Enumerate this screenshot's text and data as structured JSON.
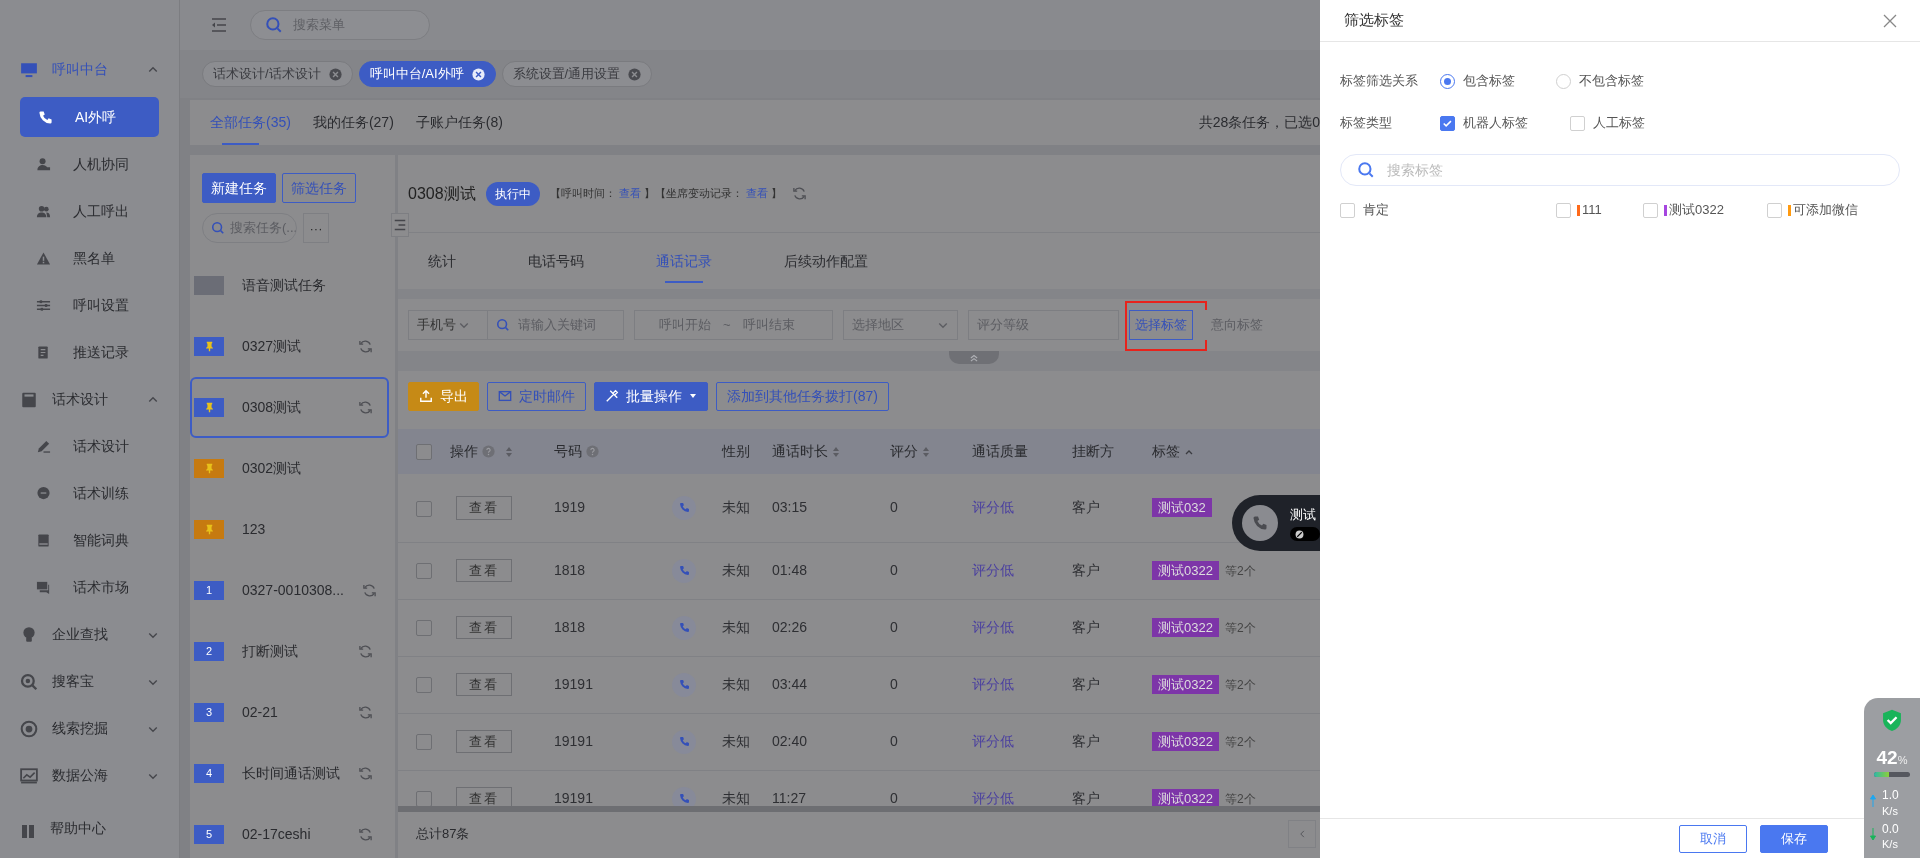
{
  "top_bar": {
    "search": {
      "placeholder": "搜索菜单"
    }
  },
  "page_tabs": [
    {
      "label": "话术设计/话术设计",
      "selected": false
    },
    {
      "label": "呼叫中台/AI外呼",
      "selected": true
    },
    {
      "label": "系统设置/通用设置",
      "selected": false
    }
  ],
  "sidebar": {
    "groups": [
      {
        "label": "呼叫中台",
        "expanded": true,
        "children": [
          {
            "label": "AI外呼",
            "selected": true
          },
          {
            "label": "人机协同",
            "selected": false
          },
          {
            "label": "人工呼出",
            "selected": false
          },
          {
            "label": "黑名单",
            "selected": false
          },
          {
            "label": "呼叫设置",
            "selected": false
          },
          {
            "label": "推送记录",
            "selected": false
          }
        ]
      },
      {
        "label": "话术设计",
        "expanded": true,
        "children": [
          {
            "label": "话术设计",
            "selected": false
          },
          {
            "label": "话术训练",
            "selected": false
          },
          {
            "label": "智能词典",
            "selected": false
          },
          {
            "label": "话术市场",
            "selected": false
          }
        ]
      },
      {
        "label": "企业查找",
        "expanded": false
      },
      {
        "label": "搜客宝",
        "expanded": false
      },
      {
        "label": "线索挖掘",
        "expanded": false
      },
      {
        "label": "数据公海",
        "expanded": false
      }
    ],
    "footer": "帮助中心"
  },
  "task_tabs": [
    {
      "label": "全部任务(35)",
      "selected": true
    },
    {
      "label": "我的任务(27)",
      "selected": false
    },
    {
      "label": "子账户任务(8)",
      "selected": false
    }
  ],
  "task_summary": "共28条任务，已选0",
  "task_panel": {
    "buttons": [
      {
        "label": "新建任务",
        "kind": "primary"
      },
      {
        "label": "筛选任务",
        "kind": "outline"
      }
    ],
    "search": {
      "placeholder": "搜索任务(..."
    },
    "more_button": "···"
  },
  "tasks": [
    {
      "name": "语音测试任务",
      "kind": "blank",
      "color": "#6b6d76",
      "refresh": false,
      "selected": false
    },
    {
      "name": "0327测试",
      "kind": "pin",
      "color": "#3d5cc4",
      "refresh": true,
      "selected": false
    },
    {
      "name": "0308测试",
      "kind": "pin",
      "color": "#3d5cc4",
      "refresh": true,
      "selected": true
    },
    {
      "name": "0302测试",
      "kind": "pin",
      "color": "#c67a10",
      "refresh": false,
      "selected": false
    },
    {
      "name": "123",
      "kind": "pin",
      "color": "#c67a10",
      "refresh": false,
      "selected": false
    },
    {
      "name": "0327-0010308...",
      "kind": "number",
      "marker_text": "1",
      "color": "#3d5cc4",
      "refresh": true,
      "selected": false
    },
    {
      "name": "打断测试",
      "kind": "number",
      "marker_text": "2",
      "color": "#3d5cc4",
      "refresh": true,
      "selected": false
    },
    {
      "name": "02-21",
      "kind": "number",
      "marker_text": "3",
      "color": "#3d5cc4",
      "refresh": true,
      "selected": false
    },
    {
      "name": "长时间通话测试",
      "kind": "number",
      "marker_text": "4",
      "color": "#3d5cc4",
      "refresh": true,
      "selected": false
    },
    {
      "name": "02-17ceshi",
      "kind": "number",
      "marker_text": "5",
      "color": "#3d5cc4",
      "refresh": true,
      "selected": false
    }
  ],
  "detail": {
    "title": "0308测试",
    "status": "执行中",
    "meta": [
      {
        "kind": "text",
        "text": "【呼叫时间："
      },
      {
        "kind": "link",
        "text": "查看"
      },
      {
        "kind": "text",
        "text": "】【坐席变动记录："
      },
      {
        "kind": "link",
        "text": "查看"
      },
      {
        "kind": "text",
        "text": "】"
      }
    ]
  },
  "detail_tabs": [
    {
      "label": "统计",
      "selected": false
    },
    {
      "label": "电话号码",
      "selected": false
    },
    {
      "label": "通话记录",
      "selected": true
    },
    {
      "label": "后续动作配置",
      "selected": false
    }
  ],
  "filters": {
    "phone_type": "手机号",
    "keyword_placeholder": "请输入关键词",
    "start_placeholder": "呼叫开始",
    "range_separator": "~",
    "end_placeholder": "呼叫结束",
    "region_placeholder": "选择地区",
    "score_placeholder": "评分等级",
    "tag_button": "选择标签",
    "tag_button_highlighted": true,
    "intent_placeholder": "意向标签"
  },
  "actions": [
    {
      "label": "导出",
      "kind": "warning"
    },
    {
      "label": "定时邮件",
      "kind": "outline"
    },
    {
      "label": "批量操作",
      "kind": "primary"
    },
    {
      "label": "添加到其他任务拨打(87)",
      "kind": "outline"
    }
  ],
  "table": {
    "columns": [
      {
        "kind": "checkbox",
        "checked": false
      },
      {
        "label": "操作",
        "help": true,
        "sortable": true
      },
      {
        "label": "号码",
        "help": true
      },
      {
        "kind": "call"
      },
      {
        "label": "性别"
      },
      {
        "label": "通话时长",
        "sortable": true
      },
      {
        "label": "评分",
        "sortable": true
      },
      {
        "label": "通话质量"
      },
      {
        "label": "挂断方"
      },
      {
        "label": "标签",
        "sorted_ascending": true
      }
    ],
    "rows": [
      {
        "checked": false,
        "action": "查看",
        "number": "1919",
        "gender": "未知",
        "duration": "03:15",
        "score": "0",
        "quality": "评分低",
        "hangup": "客户",
        "tag": "测试032"
      },
      {
        "checked": false,
        "action": "查看",
        "number": "1818",
        "gender": "未知",
        "duration": "01:48",
        "score": "0",
        "quality": "评分低",
        "hangup": "客户",
        "tag": "测试0322",
        "tag_more": "等2个"
      },
      {
        "checked": false,
        "action": "查看",
        "number": "1818",
        "gender": "未知",
        "duration": "02:26",
        "score": "0",
        "quality": "评分低",
        "hangup": "客户",
        "tag": "测试0322",
        "tag_more": "等2个"
      },
      {
        "checked": false,
        "action": "查看",
        "number": "19191",
        "gender": "未知",
        "duration": "03:44",
        "score": "0",
        "quality": "评分低",
        "hangup": "客户",
        "tag": "测试0322",
        "tag_more": "等2个"
      },
      {
        "checked": false,
        "action": "查看",
        "number": "19191",
        "gender": "未知",
        "duration": "02:40",
        "score": "0",
        "quality": "评分低",
        "hangup": "客户",
        "tag": "测试0322",
        "tag_more": "等2个"
      },
      {
        "checked": false,
        "action": "查看",
        "number": "19191",
        "gender": "未知",
        "duration": "11:27",
        "score": "0",
        "quality": "评分低",
        "hangup": "客户",
        "tag": "测试0322",
        "tag_more": "等2个"
      }
    ],
    "total": "总计87条"
  },
  "call_popup": {
    "title": "测试"
  },
  "drawer": {
    "title": "筛选标签",
    "relation": {
      "label": "标签筛选关系",
      "options": [
        {
          "label": "包含标签",
          "selected": true
        },
        {
          "label": "不包含标签",
          "selected": false
        }
      ]
    },
    "tag_type": {
      "label": "标签类型",
      "options": [
        {
          "label": "机器人标签",
          "checked": true
        },
        {
          "label": "人工标签",
          "checked": false
        }
      ]
    },
    "search": {
      "placeholder": "搜索标签"
    },
    "tags": [
      {
        "label": "肯定",
        "checked": false
      },
      {
        "label": "111",
        "checked": false,
        "color": "#ff6a1a"
      },
      {
        "label": "测试0322",
        "checked": false,
        "color": "#a646e0"
      },
      {
        "label": "可添加微信",
        "checked": false,
        "color": "#ff9a10"
      }
    ],
    "buttons": [
      {
        "label": "取消",
        "kind": "outline"
      },
      {
        "label": "保存",
        "kind": "primary"
      }
    ]
  },
  "monitor": {
    "percent": "42",
    "unit": "%",
    "level": 0.42,
    "upload": "1.0",
    "upload_unit": "K/s",
    "download": "0.0",
    "download_unit": "K/s"
  }
}
